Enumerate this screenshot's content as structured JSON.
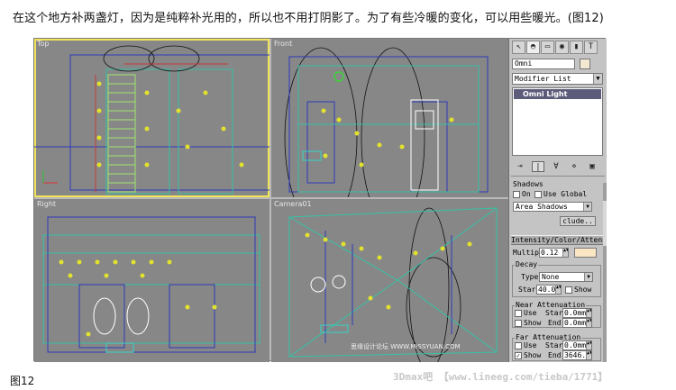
{
  "caption": "在这个地方补两盏灯，因为是纯粹补光用的，所以也不用打阴影了。为了有些冷暖的变化，可以用些暖光。(图12)",
  "figure_label": "图12",
  "watermark": "3Dmax吧 【www.lineeg.com/tieba/1771】",
  "viewports": {
    "top": "Top",
    "front": "Front",
    "right": "Right",
    "camera": "Camera01",
    "camera_watermark": "思缘设计论坛 WWW.MISSYUAN.COM"
  },
  "panel": {
    "tabs": [
      "↖",
      "◓",
      "▭",
      "◉",
      "▮",
      "T"
    ],
    "object_name": "Omni",
    "modifier_list": "Modifier List",
    "stack_item": "Omni Light",
    "stack_tools": [
      "⊸",
      "|",
      "∀",
      "⋄",
      "▣"
    ],
    "shadows": {
      "title": "Shadows",
      "on_label": "On",
      "use_global_label": "Use Global",
      "type": "Area Shadows",
      "exclude_button": "clude.."
    },
    "intensity": {
      "title": "Intensity/Color/Attenuat",
      "multiplier_label": "Multip",
      "multiplier_value": "0.12"
    },
    "decay": {
      "group_label": "Decay",
      "type_label": "Type",
      "type_value": "None",
      "start_label": "Star",
      "start_value": "40.0",
      "show_label": "Show"
    },
    "near_atten": {
      "group_label": "Near Attenuation",
      "use_label": "Use",
      "start_label": "Star",
      "start_value": "0.0mm",
      "show_label": "Show",
      "end_label": "End",
      "end_value": "0.0mm"
    },
    "far_atten": {
      "group_label": "Far Attenuation",
      "use_label": "Use",
      "start_label": "Star",
      "start_value": "0.0mm",
      "show_label": "Show",
      "end_label": "End",
      "end_value": "3646.0"
    }
  }
}
